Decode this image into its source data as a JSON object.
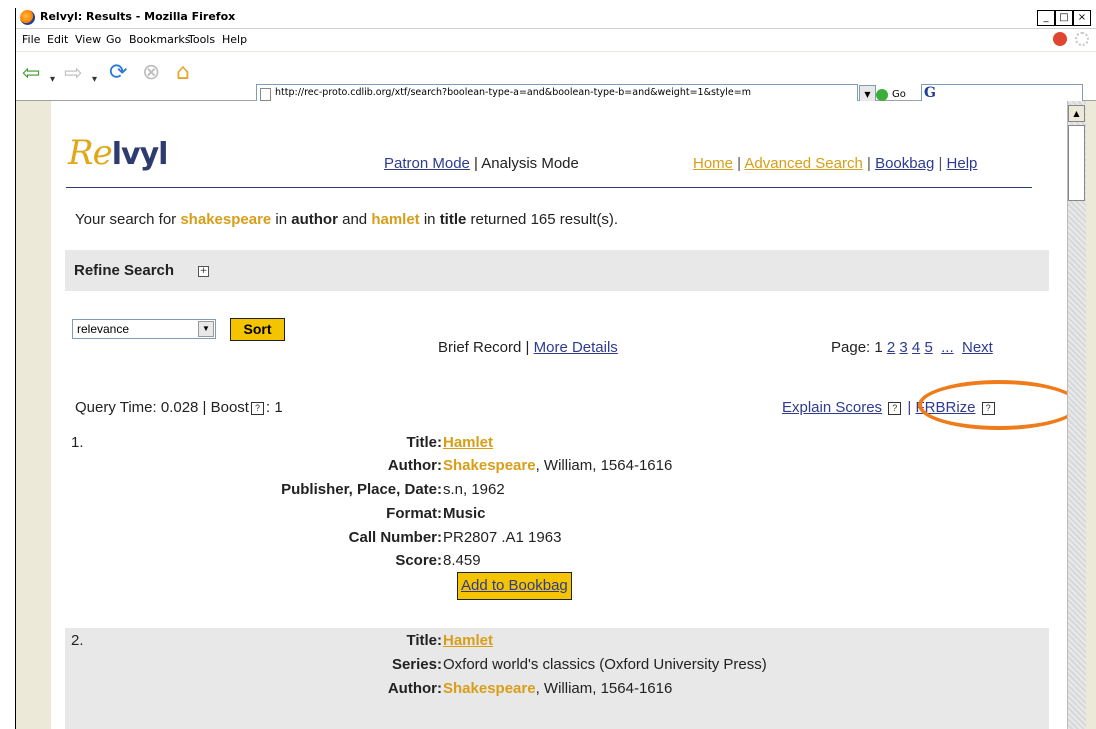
{
  "window": {
    "title": "Relvyl: Results - Mozilla Firefox",
    "controls": [
      "_",
      "□",
      "×"
    ]
  },
  "menubar": {
    "items": [
      "File",
      "Edit",
      "View",
      "Go",
      "Bookmarks",
      "Tools",
      "Help"
    ]
  },
  "toolbar": {
    "url": "http://rec-proto.cdlib.org/xtf/search?boolean-type-a=and&boolean-type-b=and&weight=1&style=m",
    "go_label": "Go",
    "google_letter": "G",
    "icons": [
      "back-arrow-icon",
      "forward-arrow-icon",
      "reload-icon",
      "stop-icon",
      "home-icon"
    ]
  },
  "site": {
    "logo_part1": "Re",
    "logo_part2": "lvyl",
    "patron_mode": "Patron Mode",
    "mode_sep": " | ",
    "analysis_mode": "Analysis Mode",
    "home": "Home",
    "advanced_search": "Advanced Search",
    "bookbag": "Bookbag",
    "help": "Help",
    "sep": " | "
  },
  "summary": {
    "prefix": "Your search for ",
    "term1": "shakespeare",
    "in1": " in ",
    "field1": "author",
    "and": " and ",
    "term2": "hamlet",
    "in2": " in ",
    "field2": "title",
    "suffix": " returned 165 result(s)."
  },
  "refine": {
    "label": "Refine Search",
    "toggle": "+"
  },
  "sort": {
    "selected": "relevance",
    "button": "Sort"
  },
  "views": {
    "brief": "Brief Record",
    "sep": " | ",
    "more": "More Details"
  },
  "paging": {
    "label": "Page: ",
    "current": "1",
    "pages": [
      "2",
      "3",
      "4",
      "5"
    ],
    "ellipsis": "...",
    "next": "Next"
  },
  "stats": {
    "query_time": "Query Time: 0.028 | Boost",
    "boost_value": ": 1",
    "help_glyph": "?"
  },
  "tools": {
    "explain": "Explain Scores",
    "frbrize": "FRBRize"
  },
  "records": [
    {
      "num": "1.",
      "fields": [
        {
          "label": "Title:",
          "value": "Hamlet"
        },
        {
          "label": "Author:",
          "value_hl": "Shakespeare",
          "value": ", William, 1564-1616"
        },
        {
          "label": "Publisher, Place, Date:",
          "value": "s.n, 1962"
        },
        {
          "label": "Format:",
          "value": "Music"
        },
        {
          "label": "Call Number:",
          "value": "PR2807 .A1 1963"
        },
        {
          "label": "Score:",
          "value": "8.459"
        }
      ],
      "button": "Add to Bookbag"
    },
    {
      "num": "2.",
      "fields": [
        {
          "label": "Title:",
          "value": "Hamlet"
        },
        {
          "label": "Series:",
          "value": "Oxford world's classics (Oxford University Press)"
        },
        {
          "label": "Author:",
          "value_hl": "Shakespeare",
          "value": ", William, 1564-1616"
        }
      ]
    }
  ],
  "colors": {
    "accent": "#d89e18",
    "link": "#2e3b8e",
    "button": "#f5c400",
    "annotation": "#ef7b1b"
  }
}
